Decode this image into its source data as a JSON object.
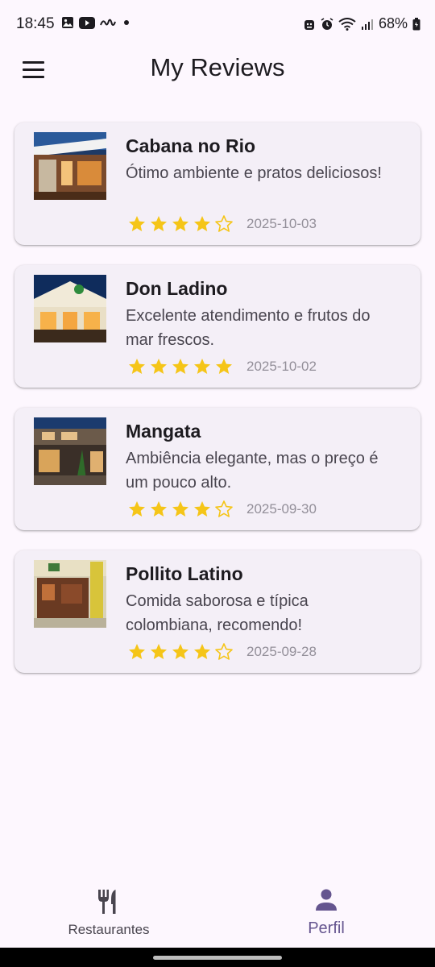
{
  "status_bar": {
    "time": "18:45",
    "left_icons": [
      "gallery-icon",
      "youtube-icon",
      "app-logo-icon",
      "dot-icon"
    ],
    "right_icons": [
      "android-head-icon",
      "alarm-icon",
      "wifi-icon",
      "signal-icon",
      "battery-icon"
    ],
    "battery": "68%"
  },
  "app_bar": {
    "title": "My Reviews",
    "menu_icon": "menu-icon"
  },
  "reviews": [
    {
      "name": "Cabana no Rio",
      "comment": "Ótimo ambiente e pratos deliciosos!",
      "rating": 4,
      "max_rating": 5,
      "date": "2025-10-03"
    },
    {
      "name": "Don Ladino",
      "comment": "Excelente atendimento e frutos do mar frescos.",
      "rating": 5,
      "max_rating": 5,
      "date": "2025-10-02"
    },
    {
      "name": "Mangata",
      "comment": "Ambiência elegante, mas o preço é um pouco alto.",
      "rating": 4,
      "max_rating": 5,
      "date": "2025-09-30"
    },
    {
      "name": "Pollito Latino",
      "comment": "Comida saborosa e típica colombiana, recomendo!",
      "rating": 4,
      "max_rating": 5,
      "date": "2025-09-28"
    }
  ],
  "bottom_nav": {
    "items": [
      {
        "label": "Restaurantes",
        "icon": "fork-knife-icon",
        "selected": false
      },
      {
        "label": "Perfil",
        "icon": "person-icon",
        "selected": true
      }
    ]
  },
  "colors": {
    "background": "#fdf7fe",
    "card": "#f4eff7",
    "star": "#f5c518",
    "selected_nav": "#65558f",
    "text_primary": "#1d1b20",
    "text_secondary": "#49454f",
    "date_text": "#938f99"
  }
}
